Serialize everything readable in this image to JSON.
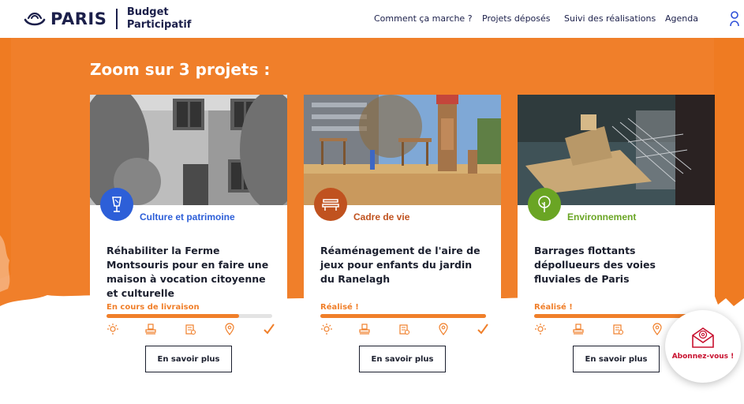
{
  "header": {
    "logo_text": "PARIS",
    "logo_sub_line1": "Budget",
    "logo_sub_line2": "Participatif",
    "nav": [
      {
        "label": "Comment ça marche ?"
      },
      {
        "label": "Projets déposés"
      },
      {
        "label": "Suivi des réalisations"
      },
      {
        "label": "Agenda"
      }
    ],
    "user_icon": "user-icon"
  },
  "section": {
    "title": "Zoom sur 3 projets :"
  },
  "colors": {
    "orange": "#f07f2a",
    "navy": "#1b1f4a",
    "culture_blue": "#2d5fd8",
    "cadre_brown": "#c0521f",
    "env_green": "#6aa524",
    "subscribe_red": "#c8102e"
  },
  "cards": [
    {
      "category": "Culture et patrimoine",
      "category_icon": "lamp-icon",
      "title": "Réhabiliter la Ferme Montsouris pour en faire une maison à vocation citoyenne et culturelle",
      "status": "En cours de livraison",
      "progress": 0.8,
      "steps": [
        "idea-icon",
        "stamp-icon",
        "ballot-icon",
        "location-pin-icon",
        "checkmark-icon"
      ],
      "button": "En savoir plus"
    },
    {
      "category": "Cadre de vie",
      "category_icon": "bench-icon",
      "title": "Réaménagement de l'aire de jeux pour enfants du jardin du Ranelagh",
      "status": "Réalisé !",
      "progress": 1.0,
      "steps": [
        "idea-icon",
        "stamp-icon",
        "ballot-icon",
        "location-pin-icon",
        "checkmark-icon"
      ],
      "button": "En savoir plus"
    },
    {
      "category": "Environnement",
      "category_icon": "tree-icon",
      "title": "Barrages flottants dépollueurs des voies fluviales de Paris",
      "status": "Réalisé !",
      "progress": 1.0,
      "steps": [
        "idea-icon",
        "stamp-icon",
        "ballot-icon",
        "location-pin-icon",
        "checkmark-icon"
      ],
      "button": "En savoir plus"
    }
  ],
  "subscribe": {
    "label": "Abonnez-vous !",
    "icon": "mail-at-icon"
  }
}
